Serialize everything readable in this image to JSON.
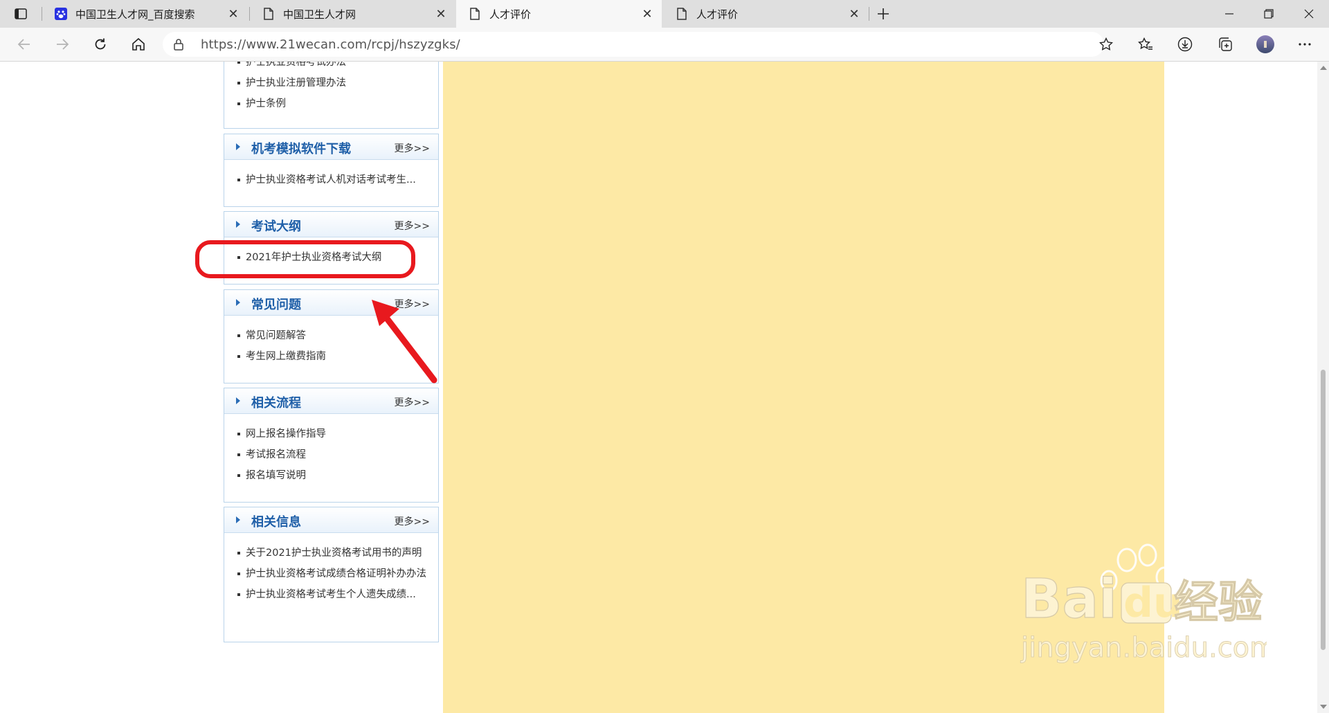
{
  "browser": {
    "tabs": [
      {
        "title": "中国卫生人才网_百度搜索",
        "icon": "baidu-paw-icon",
        "active": false
      },
      {
        "title": "中国卫生人才网",
        "icon": "document-icon",
        "active": false
      },
      {
        "title": "人才评价",
        "icon": "document-icon",
        "active": true
      },
      {
        "title": "人才评价",
        "icon": "document-icon",
        "active": false
      }
    ],
    "url": "https://www.21wecan.com/rcpj/hszyzgks/",
    "colors": {
      "tabbar": "#dfdfdf",
      "toolbar": "#f7f7f7"
    }
  },
  "sidebar": {
    "top_links": [
      "护士执业资格考试办法",
      "护士执业注册管理办法",
      "护士条例"
    ],
    "panels": [
      {
        "title": "机考模拟软件下载",
        "more": "更多>>",
        "items": [
          "护士执业资格考试人机对话考试考生..."
        ]
      },
      {
        "title": "考试大纲",
        "more": "更多>>",
        "items": [
          "2021年护士执业资格考试大纲"
        ]
      },
      {
        "title": "常见问题",
        "more": "更多>>",
        "items": [
          "常见问题解答",
          "考生网上缴费指南"
        ]
      },
      {
        "title": "相关流程",
        "more": "更多>>",
        "items": [
          "网上报名操作指导",
          "考试报名流程",
          "报名填写说明"
        ]
      },
      {
        "title": "相关信息",
        "more": "更多>>",
        "items": [
          "关于2021护士执业资格考试用书的声明",
          "护士执业资格考试成绩合格证明补办办法",
          "护士执业资格考试考生个人遗失成绩..."
        ]
      }
    ],
    "accent": "#1f5fa8"
  },
  "overlay": {
    "ad_color": "#fde9a5",
    "annotation_color": "#e8191e"
  },
  "watermark": {
    "logo": "Baidu经验",
    "url": "jingyan.baidu.com"
  }
}
